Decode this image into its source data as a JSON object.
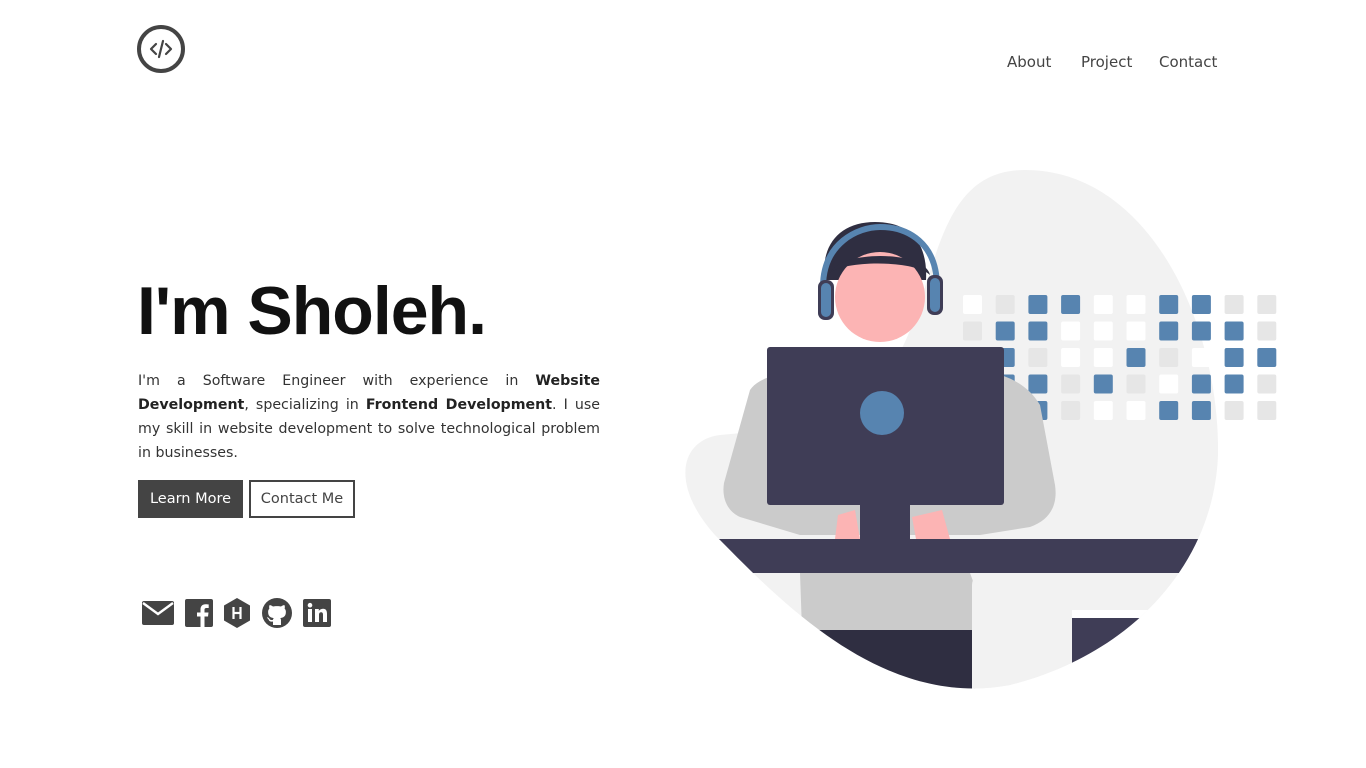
{
  "colors": {
    "dark": "#444444",
    "accent_blue": "#5784b0",
    "skin_pink": "#fcb4b4",
    "navy": "#3f3d56",
    "light_gray": "#f2f2f2"
  },
  "logo": {
    "icon": "code-brackets-icon"
  },
  "nav": {
    "items": [
      {
        "label": "About"
      },
      {
        "label": "Project"
      },
      {
        "label": "Contact"
      }
    ]
  },
  "hero": {
    "title": "I'm Sholeh.",
    "description_parts": {
      "p1": "I'm a Software Engineer with experience in ",
      "b1": "Website Development",
      "p2": ", specializing in ",
      "b2": "Frontend Development",
      "p3": ". I use my skill in website development to solve technological problem in businesses."
    },
    "buttons": {
      "learn_more": "Learn More",
      "contact_me": "Contact Me"
    }
  },
  "socials": [
    {
      "icon": "email-icon"
    },
    {
      "icon": "facebook-icon"
    },
    {
      "icon": "hackerrank-icon"
    },
    {
      "icon": "github-icon"
    },
    {
      "icon": "linkedin-icon"
    }
  ]
}
